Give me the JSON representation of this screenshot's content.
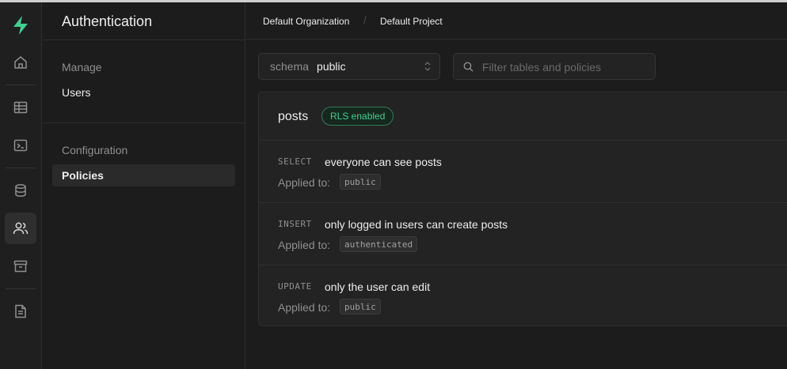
{
  "app": {
    "brand_color": "#3ecf8e",
    "title": "Authentication"
  },
  "rail": {
    "icons": [
      "supabase-logo-icon",
      "home-icon",
      "table-editor-icon",
      "sql-editor-icon",
      "database-icon",
      "auth-users-icon",
      "storage-icon",
      "docs-icon"
    ],
    "active": "auth-users-icon"
  },
  "sidebar": {
    "groups": [
      {
        "title": "Manage",
        "items": [
          {
            "label": "Users"
          }
        ]
      },
      {
        "title": "Configuration",
        "items": [
          {
            "label": "Policies"
          }
        ]
      }
    ]
  },
  "breadcrumb": {
    "organization": "Default Organization",
    "separator": "/",
    "project": "Default Project"
  },
  "schema": {
    "label": "schema",
    "value": "public"
  },
  "filter": {
    "placeholder": "Filter tables and policies",
    "value": ""
  },
  "table": {
    "name": "posts",
    "badge": "RLS enabled",
    "applied_label": "Applied to:",
    "policies": [
      {
        "command": "SELECT",
        "name": "everyone can see posts",
        "role": "public"
      },
      {
        "command": "INSERT",
        "name": "only logged in users can create posts",
        "role": "authenticated"
      },
      {
        "command": "UPDATE",
        "name": "only the user can edit",
        "role": "public"
      }
    ]
  }
}
